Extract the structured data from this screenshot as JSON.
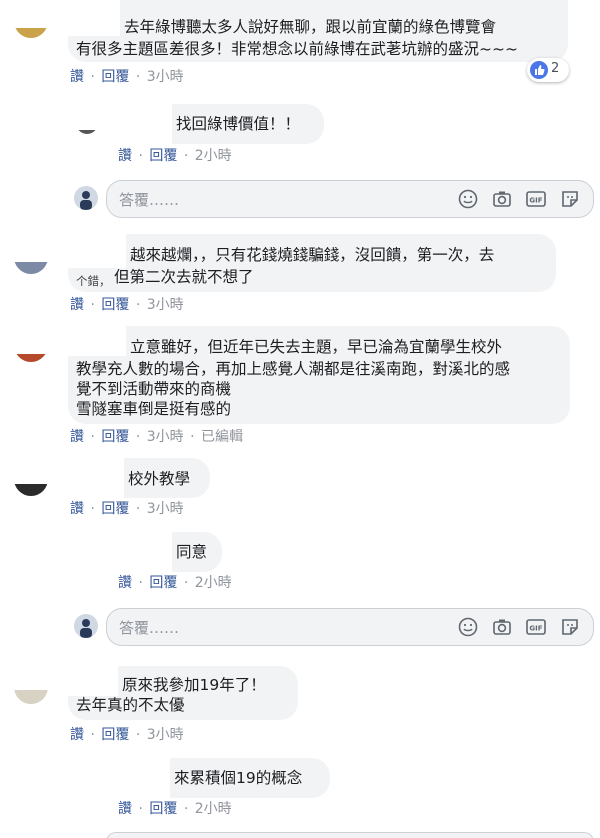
{
  "actions": {
    "like": "讚",
    "reply": "回覆",
    "dot": "·",
    "edited": "已編輯"
  },
  "reply_placeholder": "答覆……",
  "comments": [
    {
      "lines": [
        "去年綠博聽太多人說好無聊，跟以前宜蘭的綠色博覽會",
        "有很多主題區差很多！非常想念以前綠博在武荖坑辦的盛況~~~"
      ],
      "time": "3小時",
      "reactions": "2",
      "replies": [
        {
          "lines": [
            "找回綠博價值！！"
          ],
          "time": "2小時"
        }
      ]
    },
    {
      "lines": [
        "越來越爛，，只有花錢燒錢騙錢，沒回饋，第一次，去",
        "但第二次去就不想了"
      ],
      "fragment": "个錯，",
      "time": "3小時"
    },
    {
      "lines": [
        "立意雖好，但近年已失去主題，早已淪為宜蘭學生校外",
        "教學充人數的場合，再加上感覺人潮都是往溪南跑，對溪北的感",
        "覺不到活動帶來的商機",
        "雪隧塞車倒是挺有感的"
      ],
      "time": "3小時",
      "edited": true
    },
    {
      "lines": [
        "校外教學"
      ],
      "time": "3小時",
      "replies": [
        {
          "lines": [
            "同意"
          ],
          "time": "2小時"
        }
      ]
    },
    {
      "lines": [
        "原來我參加19年了！",
        "去年真的不太優"
      ],
      "time": "3小時",
      "replies": [
        {
          "lines": [
            "來累積個19的概念"
          ],
          "time": "2小時"
        }
      ]
    }
  ]
}
